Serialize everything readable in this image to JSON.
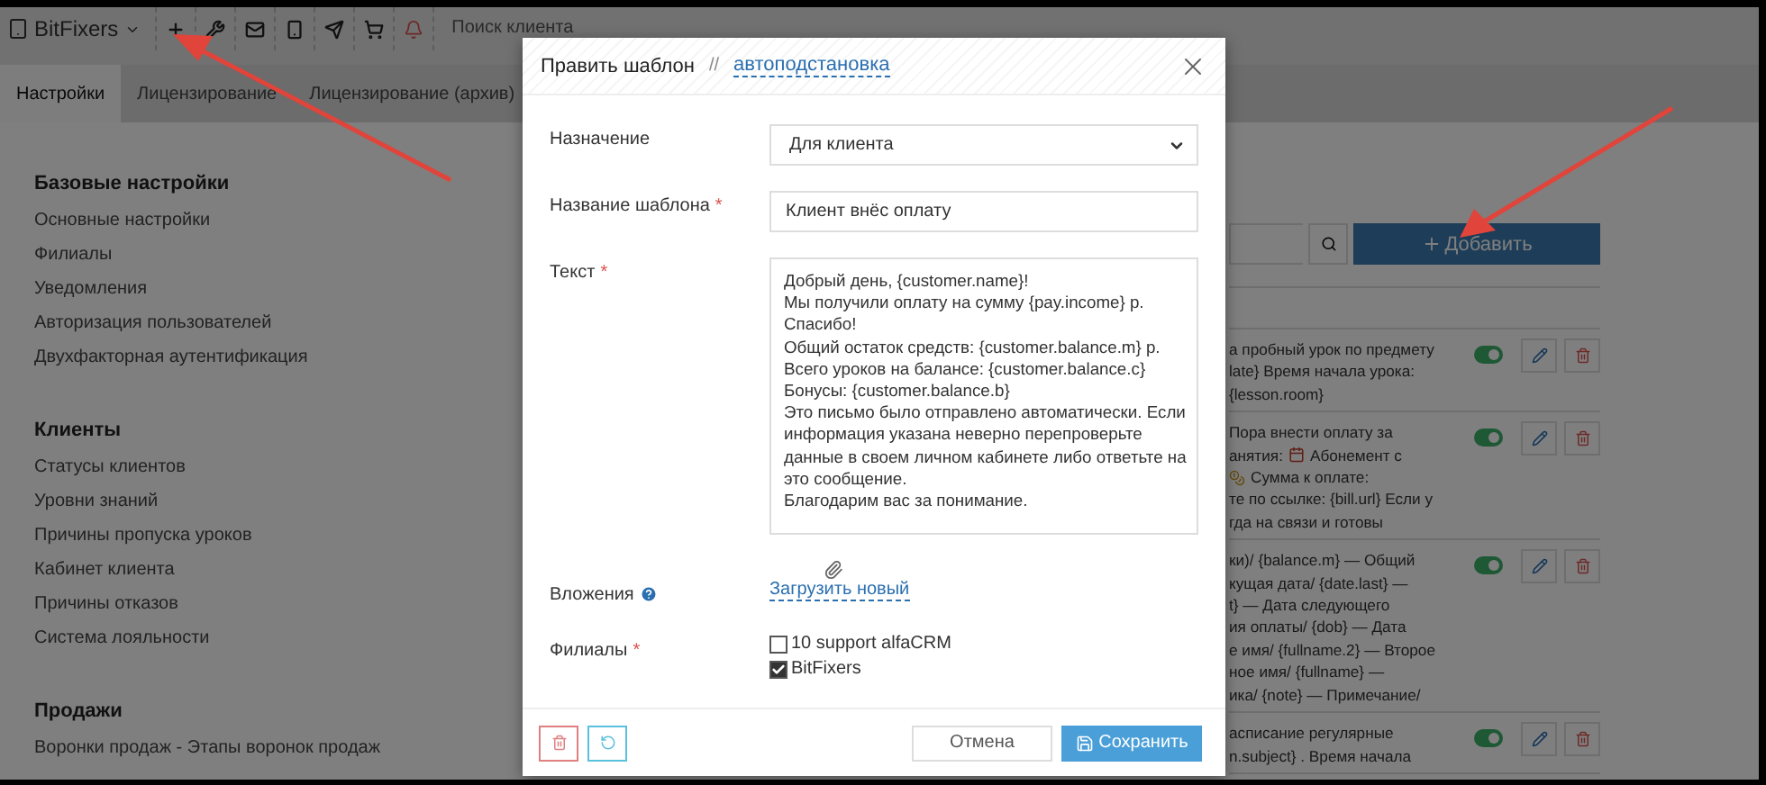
{
  "topbar": {
    "brand": "BitFixers",
    "search_placeholder": "Поиск клиента"
  },
  "tabs": [
    {
      "label": "Настройки",
      "selected": true
    },
    {
      "label": "Лицензирование",
      "selected": false
    },
    {
      "label": "Лицензирование (архив)",
      "selected": false
    }
  ],
  "sidebar": {
    "sections": [
      {
        "title": "Базовые настройки",
        "items": [
          "Основные настройки",
          "Филиалы",
          "Уведомления",
          "Авторизация пользователей",
          "Двухфакторная аутентификация"
        ]
      },
      {
        "title": "Клиенты",
        "items": [
          "Статусы клиентов",
          "Уровни знаний",
          "Причины пропуска уроков",
          "Кабинет клиента",
          "Причины отказов",
          "Система лояльности"
        ]
      },
      {
        "title": "Продажи",
        "items": [
          "Воронки продаж - Этапы воронок продаж"
        ]
      }
    ]
  },
  "content": {
    "add_button": "Добавить",
    "templates": [
      {
        "enabled": true,
        "lines": [
          {
            "kind": "plain",
            "text": "а пробный урок по предмету"
          },
          {
            "kind": "plain",
            "text": "late} Время начала урока:"
          },
          {
            "kind": "plain",
            "text": "{lesson.room}"
          }
        ]
      },
      {
        "enabled": true,
        "lines": [
          {
            "kind": "plain",
            "text": "Пора внести оплату за"
          },
          {
            "kind": "calendar",
            "text": "анятия:",
            "after": "Абонемент с"
          },
          {
            "kind": "moneybag",
            "after": "Сумма к оплате:"
          },
          {
            "kind": "plain",
            "text": "те по ссылке: {bill.url} Если у"
          },
          {
            "kind": "plain",
            "text": "гда на связи и готовы"
          }
        ]
      },
      {
        "enabled": true,
        "lines": [
          {
            "kind": "plain",
            "text": "ки)/ {balance.m} — Общий"
          },
          {
            "kind": "plain",
            "text": "кущая дата/ {date.last} —"
          },
          {
            "kind": "plain",
            "text": "t} — Дата следующего"
          },
          {
            "kind": "plain",
            "text": "ия оплаты/ {dob} — Дата"
          },
          {
            "kind": "plain",
            "text": "е имя/ {fullname.2} — Второе"
          },
          {
            "kind": "plain",
            "text": "ное имя/ {fullname} —"
          },
          {
            "kind": "plain",
            "text": "ика/ {note} — Примечание/"
          }
        ]
      },
      {
        "enabled": true,
        "lines": [
          {
            "kind": "plain",
            "text": "асписание регулярные"
          },
          {
            "kind": "plain",
            "text": "n.subject} . Время начала"
          }
        ]
      }
    ]
  },
  "modal": {
    "title": "Править шаблон",
    "separator": "//",
    "link": "автоподстановка",
    "purpose": {
      "label": "Назначение",
      "value": "Для клиента"
    },
    "name": {
      "label": "Название шаблона",
      "mark": "*",
      "value": "Клиент внёс оплату"
    },
    "text": {
      "label": "Текст",
      "mark": "*",
      "value": "Добрый день, {customer.name}!\nМы получили оплату на сумму {pay.income} р. Спасибо!\nОбщий остаток средств: {customer.balance.m} р.\nВсего уроков на балансе: {customer.balance.c}\nБонусы: {customer.balance.b}\nЭто письмо было отправлено автоматически. Если информация указана неверно перепроверьте данные в своем личном кабинете либо ответьте на это сообщение.\nБлагодарим вас за понимание."
    },
    "attachments": {
      "label": "Вложения",
      "link": "Загрузить новый"
    },
    "branches": {
      "label": "Филиалы",
      "mark": "*",
      "options": [
        {
          "label": "10 support alfaCRM",
          "checked": false
        },
        {
          "label": "BitFixers",
          "checked": true
        }
      ]
    },
    "cancel": "Отмена",
    "save": "Сохранить"
  }
}
